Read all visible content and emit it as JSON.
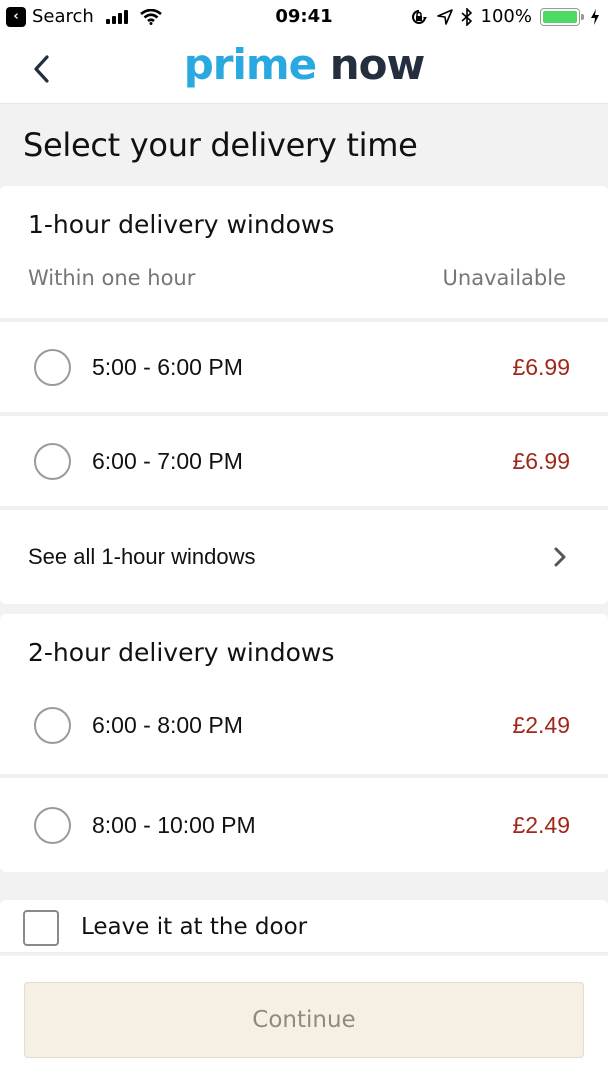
{
  "status_bar": {
    "back_app_label": "Search",
    "time": "09:41",
    "battery_percent": "100%",
    "battery_level": 1.0,
    "icons": [
      "back-app-icon",
      "signal-icon",
      "wifi-icon",
      "rotation-lock-icon",
      "location-icon",
      "bluetooth-icon",
      "battery-icon",
      "charging-icon"
    ]
  },
  "nav": {
    "back_icon": "chevron-left-icon",
    "logo_part1": "prime",
    "logo_part2": "now",
    "colors": {
      "prime": "#2aa8e0",
      "now": "#232f3e"
    }
  },
  "page": {
    "title": "Select your delivery time"
  },
  "one_hour": {
    "title": "1-hour delivery windows",
    "within_label": "Within one hour",
    "within_status": "Unavailable",
    "slots": [
      {
        "time": "5:00 - 6:00 PM",
        "price": "£6.99",
        "selected": false
      },
      {
        "time": "6:00 - 7:00 PM",
        "price": "£6.99",
        "selected": false
      }
    ],
    "see_all_label": "See all 1-hour windows"
  },
  "two_hour": {
    "title": "2-hour delivery windows",
    "slots": [
      {
        "time": "6:00 - 8:00 PM",
        "price": "£2.49",
        "selected": false
      },
      {
        "time": "8:00 - 10:00 PM",
        "price": "£2.49",
        "selected": false
      }
    ]
  },
  "door_option": {
    "label": "Leave it at the door",
    "checked": false
  },
  "footer": {
    "continue_label": "Continue",
    "continue_enabled": false
  },
  "colors": {
    "price": "#a0281a",
    "continue_bg": "#f6f0e4",
    "battery": "#4cd964"
  }
}
